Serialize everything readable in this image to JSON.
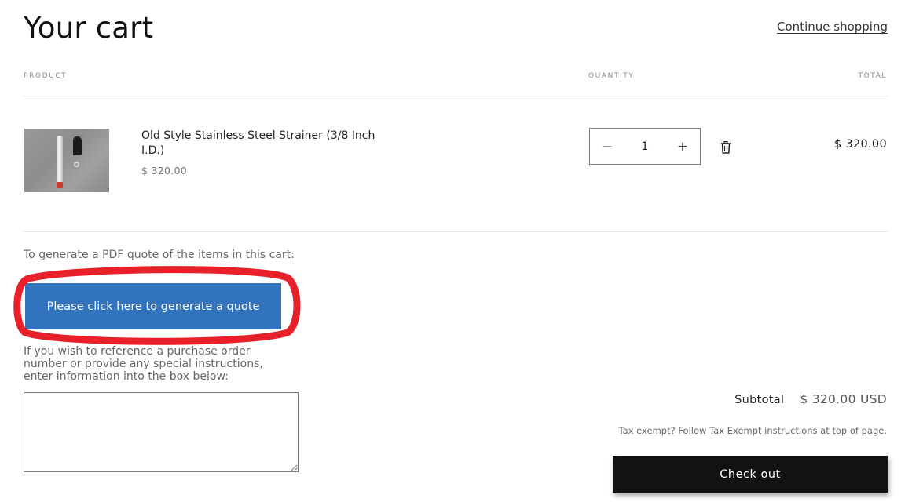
{
  "header": {
    "title": "Your cart",
    "continue_shopping": "Continue shopping"
  },
  "table": {
    "columns": [
      "Product",
      "Quantity",
      "Total"
    ]
  },
  "items": [
    {
      "name": "Old Style Stainless Steel Strainer (3/8 Inch I.D.)",
      "unit_price": "$ 320.00",
      "quantity": "1",
      "line_total": "$ 320.00",
      "image_icon": "product-photo-strainer"
    }
  ],
  "quantity_controls": {
    "decrease": "−",
    "increase": "+",
    "remove_icon": "trash-icon"
  },
  "quote": {
    "intro": "To generate a PDF quote of the items in this cart:",
    "button_label": "Please click here to generate a quote",
    "instructions": "If you wish to reference a purchase order number or provide any special instructions, enter information into the box below:",
    "notes_value": "",
    "highlight_color": "#e8202a",
    "button_color": "#3174bd"
  },
  "summary": {
    "subtotal_label": "Subtotal",
    "subtotal_value": "$ 320.00 USD",
    "tax_note": "Tax exempt? Follow Tax Exempt instructions at top of page.",
    "checkout_label": "Check out"
  }
}
